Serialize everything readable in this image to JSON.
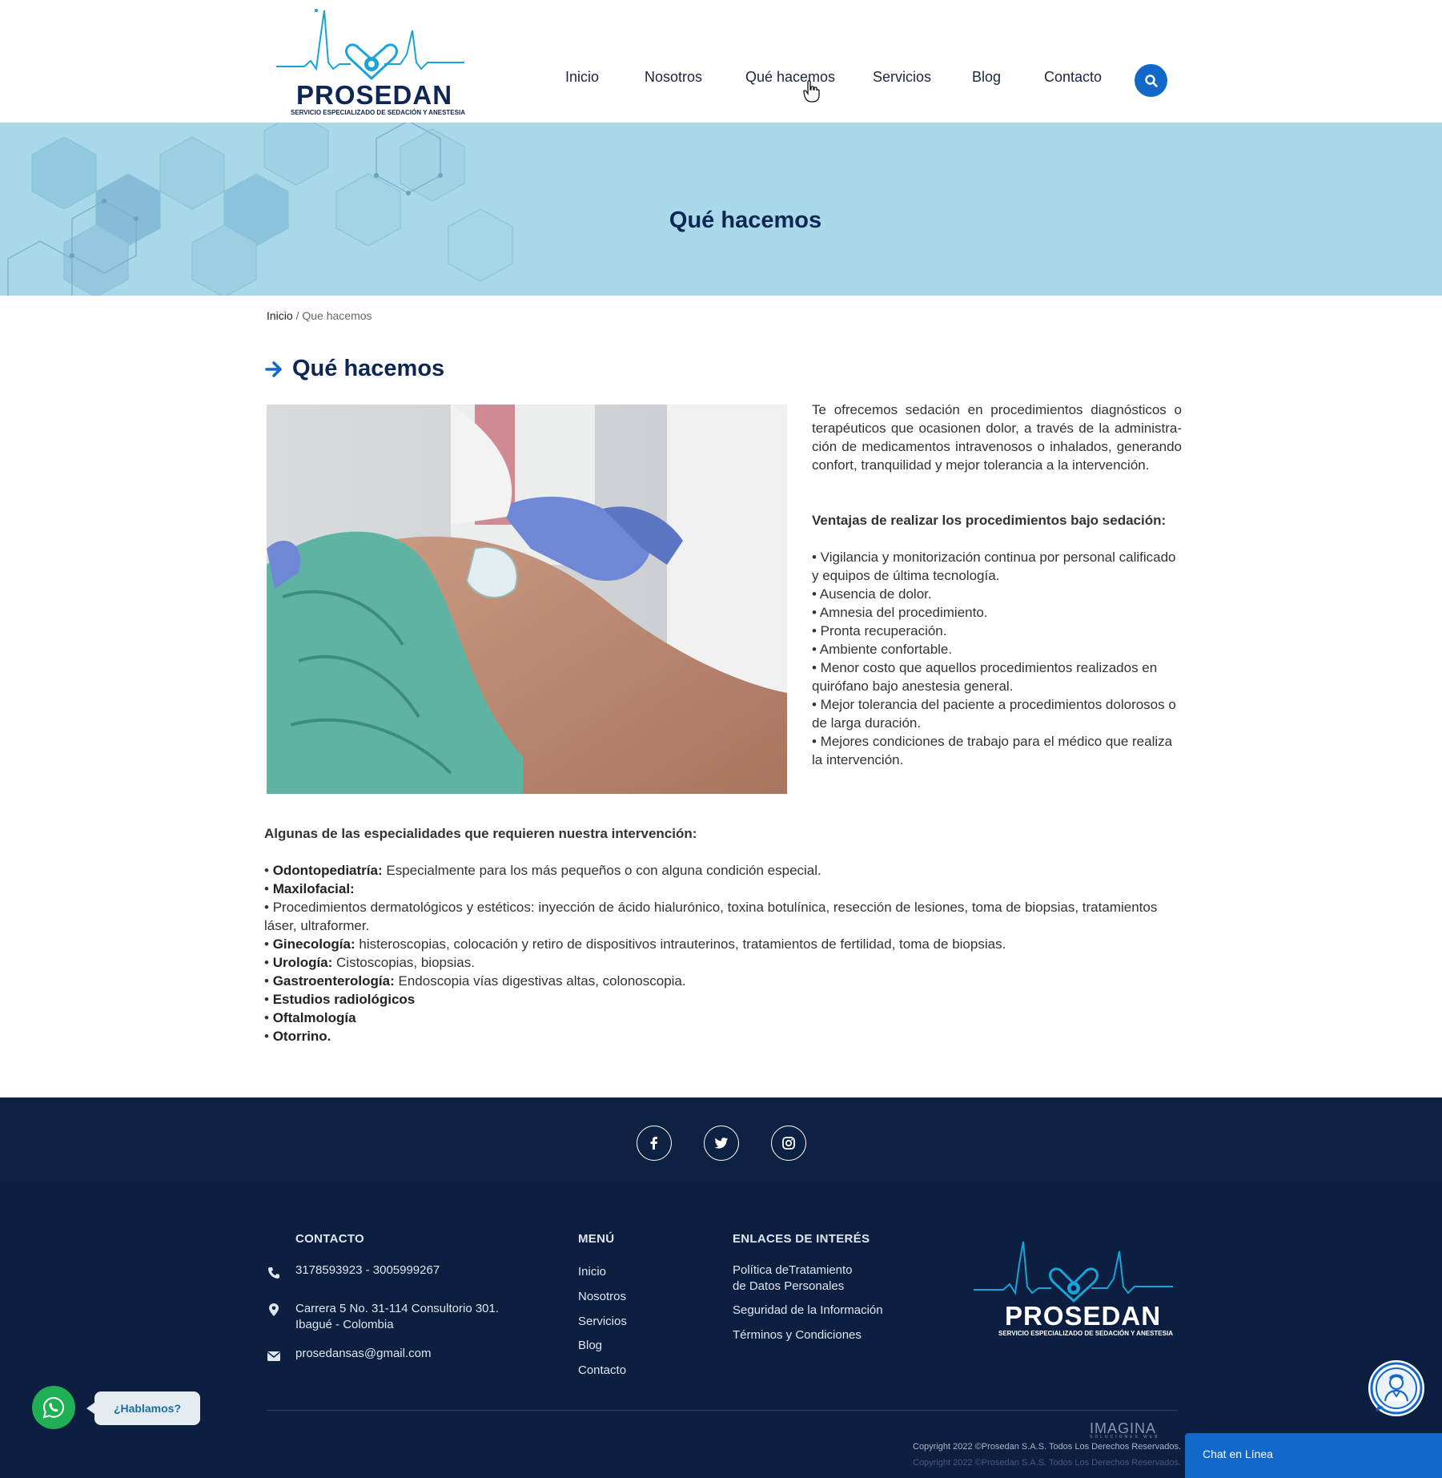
{
  "header": {
    "logo": {
      "brand": "PROSEDAN",
      "tagline": "SERVICIO ESPECIALIZADO DE SEDACIÓN Y ANESTESIA"
    },
    "nav": [
      {
        "label": "Inicio"
      },
      {
        "label": "Nosotros"
      },
      {
        "label": "Qué hacemos",
        "active": true
      },
      {
        "label": "Servicios"
      },
      {
        "label": "Blog"
      },
      {
        "label": "Contacto"
      }
    ],
    "search_icon": "search-icon",
    "accent_color": "#1268c9"
  },
  "banner": {
    "title": "Qué hacemos",
    "background_color": "#a9d9e8"
  },
  "breadcrumb": {
    "home": "Inicio",
    "separator": "/",
    "current": "Que hacemos"
  },
  "content": {
    "title": "Qué hacemos",
    "intro": "Te ofrecemos sedación en procedimientos diagnósticos o terapéuticos que ocasionen dolor, a través de la administra­ción de medicamentos intravenosos o inhalados, generando confort, tranquilidad y mejor tolerancia a la intervención.",
    "advantages_title": "Ventajas de realizar los procedimientos bajo sedación:",
    "advantages": [
      "• Vigilancia y monitorización continua por personal calificado y equipos de última tecnología.",
      "• Ausencia de dolor.",
      "• Amnesia del procedimiento.",
      "• Pronta recuperación.",
      "• Ambiente confortable.",
      "• Menor costo que aquellos procedimientos realizados en qui­rófano bajo anestesia general.",
      "• Mejor tolerancia del paciente a procedimientos dolorosos o de larga duración.",
      "• Mejores condiciones de trabajo para el médico que realiza la intervención."
    ],
    "specialties_title": "Algunas de las especialidades que requieren nuestra intervención:",
    "specialties": [
      {
        "bullet": "• ",
        "name": "Odontopediatría:",
        "desc": " Especialmente para los más pequeños o con alguna condición especial."
      },
      {
        "bullet": "• ",
        "name": "Maxilofacial:",
        "desc": ""
      },
      {
        "bullet": "• ",
        "name": "",
        "desc": "Procedimientos dermatológicos y estéticos: inyección de ácido hialurónico, toxina botulínica, resección de lesiones, toma de biopsias, tratamientos láser, ultraformer."
      },
      {
        "bullet": "• ",
        "name": "Ginecología:",
        "desc": " histeroscopias, colocación y retiro de dispositivos intrauterinos, tratamientos de fertilidad, toma de biopsias."
      },
      {
        "bullet": "• ",
        "name": "Urología:",
        "desc": " Cistoscopias, biopsias."
      },
      {
        "bullet": "• ",
        "name": "Gastroenterología:",
        "desc": " Endoscopia vías digestivas altas, colonoscopia."
      },
      {
        "bullet": "• ",
        "name": "Estudios radiológicos",
        "desc": ""
      },
      {
        "bullet": "• ",
        "name": "Oftalmología",
        "desc": ""
      },
      {
        "bullet": "• ",
        "name": "Otorrino.",
        "desc": ""
      }
    ]
  },
  "footer": {
    "social": [
      "facebook-icon",
      "twitter-icon",
      "instagram-icon"
    ],
    "contact": {
      "title": "CONTACTO",
      "phone": "3178593923 - 3005999267",
      "address_line1": "Carrera 5 No. 31-114 Consultorio 301.",
      "address_line2": "Ibagué - Colombia",
      "email": "prosedansas@gmail.com"
    },
    "menu": {
      "title": "MENÚ",
      "items": [
        "Inicio",
        "Nosotros",
        "Servicios",
        "Blog",
        "Contacto"
      ]
    },
    "links": {
      "title": "ENLACES DE INTERÉS",
      "policy_line1": "Política deTratamiento",
      "policy_line2": "de Datos Personales",
      "security": "Seguridad de la Información",
      "terms": "Términos y Condiciones"
    },
    "logo": {
      "brand": "PROSEDAN",
      "tagline": "SERVICIO ESPECIALIZADO DE SEDACIÓN Y ANESTESIA"
    },
    "agency": "IMAGINA",
    "agency_sub": "SOLUCIONES WEB",
    "copyright": "Copyright 2022 ©Prosedan S.A.S. Todos Los Derechos Reservados.",
    "background_color": "#0c1f40"
  },
  "widgets": {
    "whatsapp_label": "¿Hablamos?",
    "chat_label": "Chat en Línea"
  }
}
